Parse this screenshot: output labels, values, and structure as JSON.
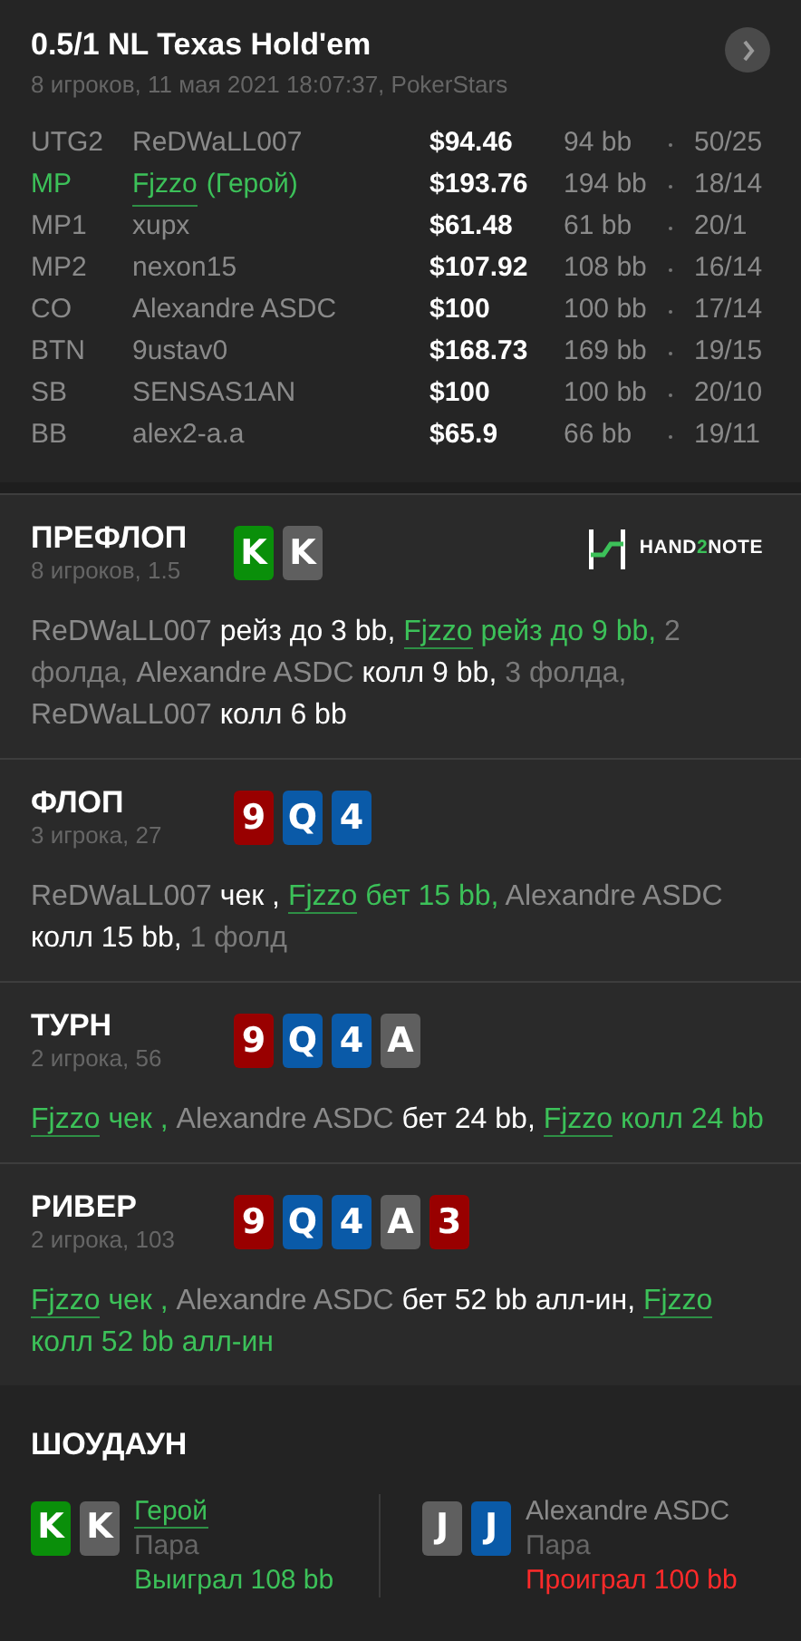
{
  "header": {
    "title": "0.5/1 NL Texas Hold'em",
    "subtitle": "8 игроков, 11 мая 2021 18:07:37, PokerStars"
  },
  "players": [
    {
      "position": "UTG2",
      "name": "ReDWaLL007",
      "hero": false,
      "stack": "$94.46",
      "bb": "94 bb",
      "stats": "50/25"
    },
    {
      "position": "MP",
      "name": "Fjzzo",
      "hero": true,
      "hero_tag": "(Герой)",
      "stack": "$193.76",
      "bb": "194 bb",
      "stats": "18/14"
    },
    {
      "position": "MP1",
      "name": "xupx",
      "hero": false,
      "stack": "$61.48",
      "bb": "61 bb",
      "stats": "20/1"
    },
    {
      "position": "MP2",
      "name": "nexon15",
      "hero": false,
      "stack": "$107.92",
      "bb": "108 bb",
      "stats": "16/14"
    },
    {
      "position": "CO",
      "name": "Alexandre ASDC",
      "hero": false,
      "stack": "$100",
      "bb": "100 bb",
      "stats": "17/14"
    },
    {
      "position": "BTN",
      "name": "9ustav0",
      "hero": false,
      "stack": "$168.73",
      "bb": "169 bb",
      "stats": "19/15"
    },
    {
      "position": "SB",
      "name": "SENSAS1AN",
      "hero": false,
      "stack": "$100",
      "bb": "100 bb",
      "stats": "20/10"
    },
    {
      "position": "BB",
      "name": "alex2-a.a",
      "hero": false,
      "stack": "$65.9",
      "bb": "66 bb",
      "stats": "19/11"
    }
  ],
  "logo": {
    "text": "HAND2NOTE"
  },
  "streets": [
    {
      "title": "ПРЕФЛОП",
      "info": "8 игроков, 1.5",
      "cards": [
        {
          "rank": "K",
          "color": "#0a8f0a"
        },
        {
          "rank": "K",
          "color": "#5f5f5f"
        }
      ],
      "actions": [
        {
          "kind": "player",
          "text": "ReDWaLL007"
        },
        {
          "kind": "action",
          "text": "рейз до 3 bb,"
        },
        {
          "kind": "hero",
          "text": "Fjzzo"
        },
        {
          "kind": "hero_action",
          "text": "рейз до 9 bb,"
        },
        {
          "kind": "note",
          "text": "2 фолда,"
        },
        {
          "kind": "player",
          "text": "Alexandre ASDC"
        },
        {
          "kind": "action",
          "text": "колл 9 bb,"
        },
        {
          "kind": "note",
          "text": "3 фолда,"
        },
        {
          "kind": "player",
          "text": "ReDWaLL007"
        },
        {
          "kind": "action",
          "text": "колл 6 bb"
        }
      ]
    },
    {
      "title": "ФЛОП",
      "info": "3 игрока, 27",
      "cards": [
        {
          "rank": "9",
          "color": "#990000"
        },
        {
          "rank": "Q",
          "color": "#0a5aa8"
        },
        {
          "rank": "4",
          "color": "#0a5aa8"
        }
      ],
      "actions": [
        {
          "kind": "player",
          "text": "ReDWaLL007"
        },
        {
          "kind": "action",
          "text": "чек ,"
        },
        {
          "kind": "hero",
          "text": "Fjzzo"
        },
        {
          "kind": "hero_action",
          "text": "бет 15 bb,"
        },
        {
          "kind": "player",
          "text": "Alexandre ASDC"
        },
        {
          "kind": "action",
          "text": "колл 15 bb,"
        },
        {
          "kind": "note",
          "text": "1 фолд"
        }
      ]
    },
    {
      "title": "ТУРН",
      "info": "2 игрока, 56",
      "cards": [
        {
          "rank": "9",
          "color": "#990000"
        },
        {
          "rank": "Q",
          "color": "#0a5aa8"
        },
        {
          "rank": "4",
          "color": "#0a5aa8"
        },
        {
          "rank": "A",
          "color": "#5f5f5f"
        }
      ],
      "actions": [
        {
          "kind": "hero",
          "text": "Fjzzo"
        },
        {
          "kind": "hero_action",
          "text": "чек ,"
        },
        {
          "kind": "player",
          "text": "Alexandre ASDC"
        },
        {
          "kind": "action",
          "text": "бет 24 bb,"
        },
        {
          "kind": "hero",
          "text": "Fjzzo"
        },
        {
          "kind": "hero_action",
          "text": "колл 24 bb"
        }
      ]
    },
    {
      "title": "РИВЕР",
      "info": "2 игрока, 103",
      "cards": [
        {
          "rank": "9",
          "color": "#990000"
        },
        {
          "rank": "Q",
          "color": "#0a5aa8"
        },
        {
          "rank": "4",
          "color": "#0a5aa8"
        },
        {
          "rank": "A",
          "color": "#5f5f5f"
        },
        {
          "rank": "3",
          "color": "#990000"
        }
      ],
      "actions": [
        {
          "kind": "hero",
          "text": "Fjzzo"
        },
        {
          "kind": "hero_action",
          "text": "чек ,"
        },
        {
          "kind": "player",
          "text": "Alexandre ASDC"
        },
        {
          "kind": "action",
          "text": "бет 52 bb алл-ин,"
        },
        {
          "kind": "hero",
          "text": "Fjzzo"
        },
        {
          "kind": "hero_action",
          "text": "колл 52 bb алл-ин"
        }
      ]
    }
  ],
  "showdown": {
    "title": "ШОУДАУН",
    "hands": [
      {
        "name": "Герой",
        "hero": true,
        "cards": [
          {
            "rank": "K",
            "color": "#0a8f0a"
          },
          {
            "rank": "K",
            "color": "#5f5f5f"
          }
        ],
        "hand": "Пара",
        "result": "Выиграл 108 bb",
        "won": true
      },
      {
        "name": "Alexandre ASDC",
        "hero": false,
        "cards": [
          {
            "rank": "J",
            "color": "#5f5f5f"
          },
          {
            "rank": "J",
            "color": "#0a5aa8"
          }
        ],
        "hand": "Пара",
        "result": "Проиграл 100 bb",
        "won": false
      }
    ]
  }
}
